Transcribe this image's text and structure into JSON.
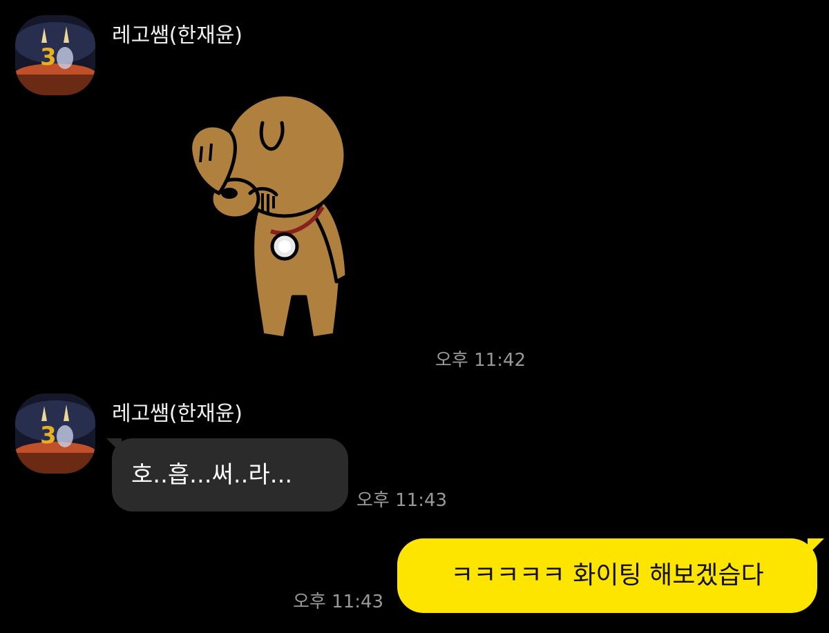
{
  "colors": {
    "background": "#000000",
    "incoming_bubble": "#2b2b2b",
    "outgoing_bubble": "#fee500",
    "timestamp": "#9a9a9a"
  },
  "messages": [
    {
      "sender": "레고쌤(한재윤)",
      "type": "sticker",
      "sticker_icon": "brown-bear-facepalm-sticker",
      "time": "오후 11:42"
    },
    {
      "sender": "레고쌤(한재윤)",
      "type": "text",
      "text": "호..흡...써..라...",
      "time": "오후 11:43"
    },
    {
      "type": "text",
      "outgoing": true,
      "text": "ㅋㅋㅋㅋㅋ 화이팅 해보겠습다",
      "time": "오후 11:43"
    }
  ]
}
